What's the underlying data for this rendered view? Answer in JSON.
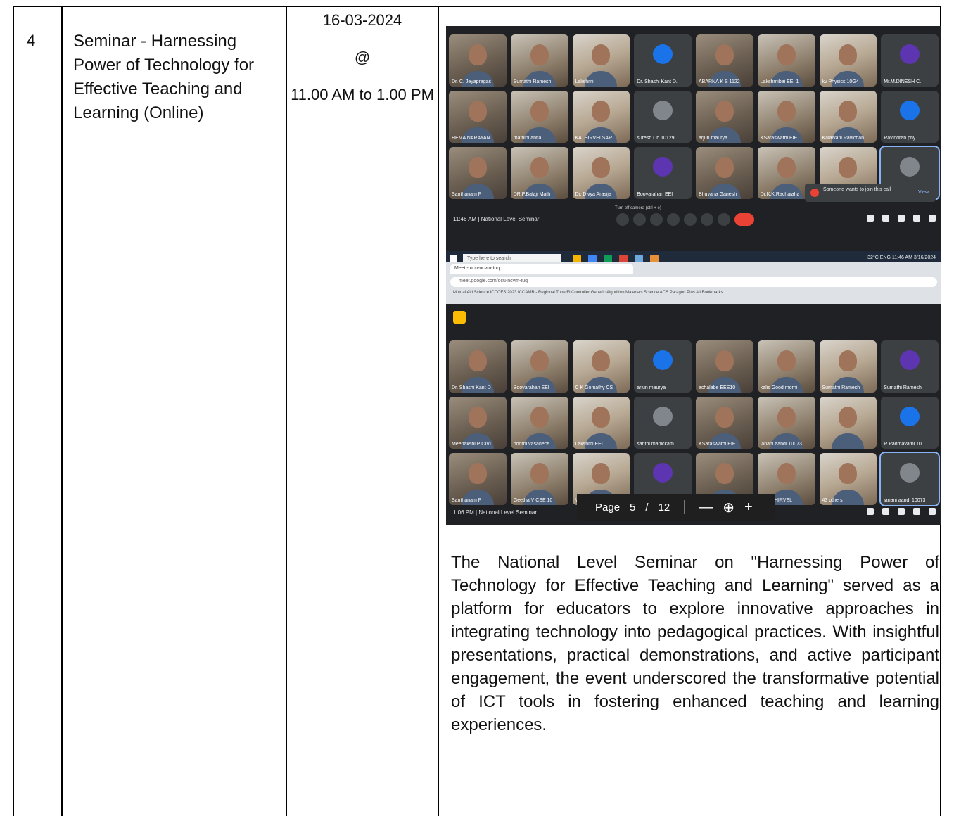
{
  "row": {
    "number": "4",
    "title": "Seminar - Harnessing Power of Technology for Effective Teaching and Learning (Online)",
    "date": "16-03-2024",
    "at": "@",
    "time": "11.00 AM to 1.00 PM",
    "description": "The National Level Seminar on \"Harnessing Power of Technology for Effective Teaching and Learning\" served as a platform for educators to explore innovative approaches in integrating technology into pedagogical practices. With insightful presentations, practical demonstrations, and active participant engagement, the event underscored the transformative potential of ICT tools in fostering enhanced teaching and learning experiences."
  },
  "screenshot_1": {
    "participants": [
      "Dr. C. Jeyapragas",
      "Sumathi Ramesh",
      "Lakshmi",
      "Dr. Shashi Kant D.",
      "ABARNA K S 1122",
      "Lakshmibai EEI 1",
      "kv Physics 10G4",
      "Mr.M.DINESH C.",
      "HEMA NARAYAN",
      "mathini antia",
      "KATHIRVELSAR",
      "suresh Ch 10129",
      "arjun maurya",
      "KSaraswathi EIE",
      "Kalaivani Ravichan",
      "Ravindran phy",
      "Santhanam P",
      "DR.P.Balaji Math",
      "Dr. Divya Arasija",
      "Boovarahan EEI",
      "Bhuvana Ganesh",
      "Dr.K.K.Rachaiaha",
      "",
      ""
    ],
    "toast_text": "Someone wants to join this call",
    "toast_action": "View",
    "meeting_label": "11:46 AM | National Level Seminar",
    "camera_tooltip": "Turn off camera (ctrl + e)",
    "taskbar_search": "Type here to search",
    "taskbar_tray": "32°C  ENG  11:46 AM  3/16/2024"
  },
  "screenshot_2": {
    "tab_label": "Meet - ocu-ncvm-tuq",
    "url": "meet.google.com/ocu-ncvm-tuq",
    "bookmarks": "Mutual Aid Science  ICCCES 2023  ICCAMR - Regional  Tune Fi Controller  Generic Algorithm  Materials Science  ACS Paragon Plus   All Bookmarks",
    "participants": [
      "Dr. Shashi Kant D",
      "Boovarahan EEI",
      "C K Gomathy CS",
      "arjun maurya",
      "achalabe EEE10",
      "kalis Good morni",
      "Sumathi Ramesh",
      "Sumathi Ramesh",
      "Meenakshi P CIVI",
      "poorni vasanece",
      "Lakshmi EEI",
      "santhi manickam",
      "KSaraswathi EIE",
      "janani aandi 10073",
      "",
      "R.Padmavathi 10",
      "Santhanam P",
      "Geetha V CSE 10",
      "V.KOMALA Lab",
      "Lakshmibai EEI 1",
      "Rajeswari",
      "C.KATHIRVEL",
      "43 others",
      "janani aandi 10073"
    ],
    "meeting_label": "1:06 PM | National Level Seminar",
    "pdf_page_label": "Page",
    "pdf_page_current": "5",
    "pdf_page_sep": "/",
    "pdf_page_total": "12",
    "pdf_zoom_out": "—",
    "pdf_zoom_icon": "⊕",
    "pdf_zoom_in": "+"
  }
}
